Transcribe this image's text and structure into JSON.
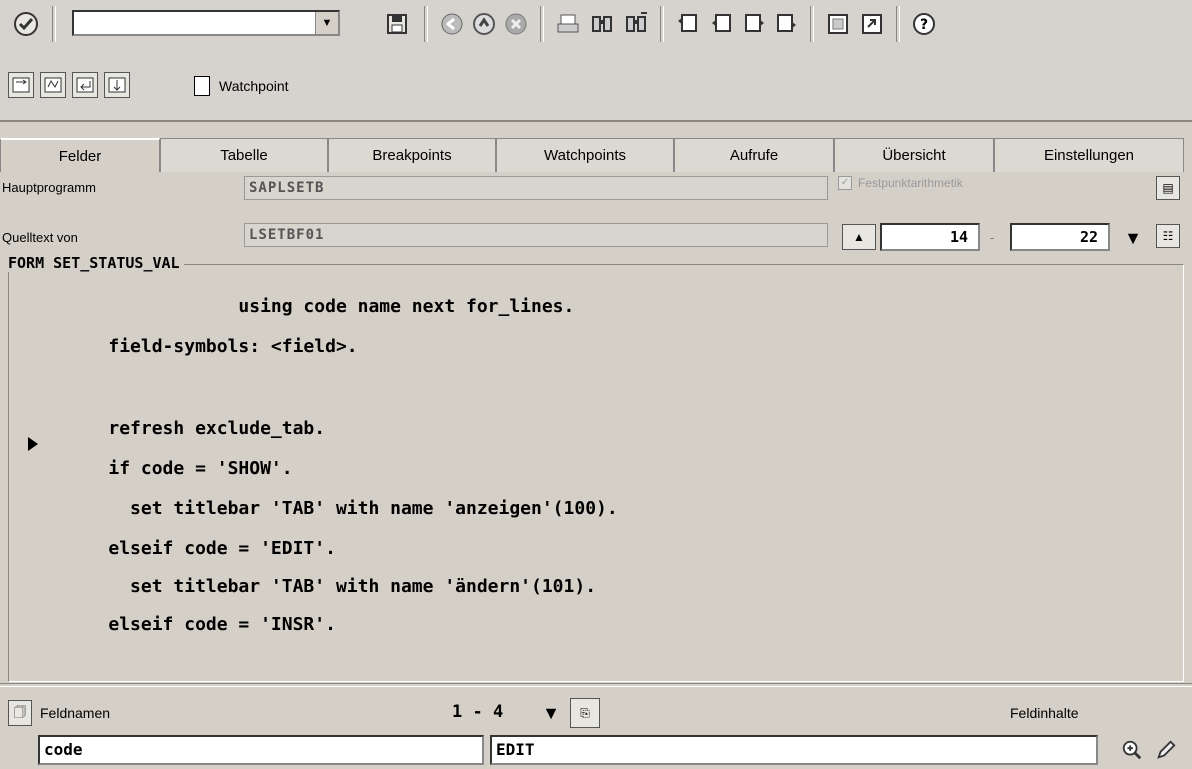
{
  "toolbar": {
    "command_field_value": "",
    "icons": [
      "enter-icon",
      "save-icon",
      "back-icon",
      "exit-icon",
      "cancel-icon",
      "print-icon",
      "find-icon",
      "find-next-icon",
      "first-page-icon",
      "previous-page-icon",
      "next-page-icon",
      "last-page-icon",
      "create-session-icon",
      "shortcut-icon",
      "help-icon"
    ]
  },
  "app_toolbar": {
    "watchpoint_label": "Watchpoint"
  },
  "tabs": [
    {
      "label": "Felder"
    },
    {
      "label": "Tabelle"
    },
    {
      "label": "Breakpoints"
    },
    {
      "label": "Watchpoints"
    },
    {
      "label": "Aufrufe"
    },
    {
      "label": "Übersicht"
    },
    {
      "label": "Einstellungen"
    }
  ],
  "info": {
    "main_program_label": "Hauptprogramm",
    "main_program_value": "SAPLSETB",
    "source_label": "Quelltext von",
    "source_value": "LSETBF01",
    "fixed_point_label": "Festpunktarithmetik",
    "fixed_point_checked": true,
    "line_from": "14",
    "line_sep": "-",
    "line_to": "22"
  },
  "source": {
    "form_title": "FORM SET_STATUS_VAL",
    "lines": [
      "                      using code name next for_lines.",
      "          field-symbols: <field>.",
      "",
      "          refresh exclude_tab.",
      "          if code = 'SHOW'.",
      "            set titlebar 'TAB' with name 'anzeigen'(100).",
      "          elseif code = 'EDIT'.",
      "            set titlebar 'TAB' with name 'ändern'(101).",
      "          elseif code = 'INSR'."
    ]
  },
  "bottom": {
    "field_names_label": "Feldnamen",
    "range_text": "1 - 4",
    "field_contents_label": "Feldinhalte",
    "field_name_value": "code",
    "field_content_value": "EDIT"
  }
}
